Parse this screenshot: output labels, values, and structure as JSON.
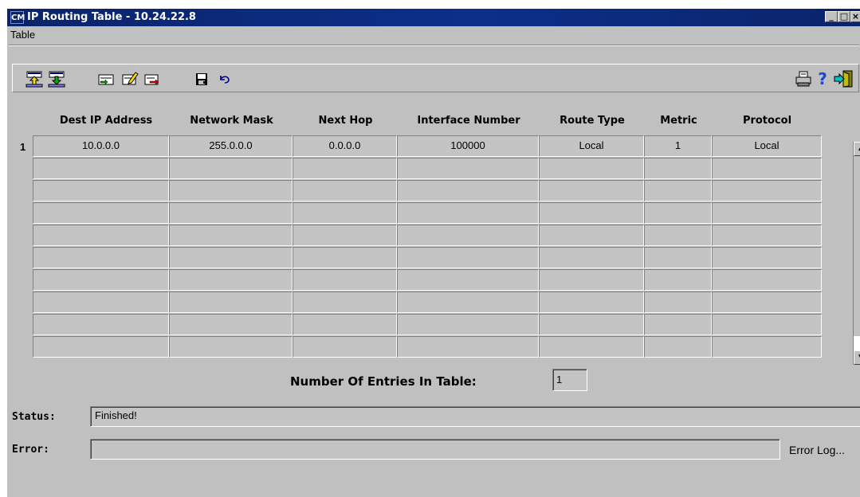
{
  "window": {
    "title": "IP Routing Table - 10.24.22.8",
    "app_icon_text": "CM",
    "controls": [
      "_",
      "□",
      "×"
    ]
  },
  "menu": {
    "table": "Table"
  },
  "toolbar": {
    "left_icons": [
      "import-icon",
      "export-icon",
      "add-row-icon",
      "edit-row-icon",
      "delete-row-icon",
      "save-icon",
      "undo-icon"
    ],
    "right_icons": [
      "print-icon",
      "help-icon",
      "exit-icon"
    ],
    "help_glyph": "?"
  },
  "table": {
    "columns": [
      "Dest IP Address",
      "Network Mask",
      "Next Hop",
      "Interface Number",
      "Route Type",
      "Metric",
      "Protocol"
    ],
    "rows": [
      {
        "num": "1",
        "cells": [
          "10.0.0.0",
          "255.0.0.0",
          "0.0.0.0",
          "100000",
          "Local",
          "1",
          "Local"
        ]
      }
    ]
  },
  "entries": {
    "label": "Number Of Entries In Table:",
    "value": "1"
  },
  "status": {
    "label": "Status:",
    "value": "Finished!"
  },
  "error": {
    "label": "Error:",
    "value": "",
    "log_link": "Error Log..."
  },
  "colors": {
    "titlebar": "#0a246a",
    "face": "#c0c0c0",
    "cell": "#c4c4c4"
  }
}
